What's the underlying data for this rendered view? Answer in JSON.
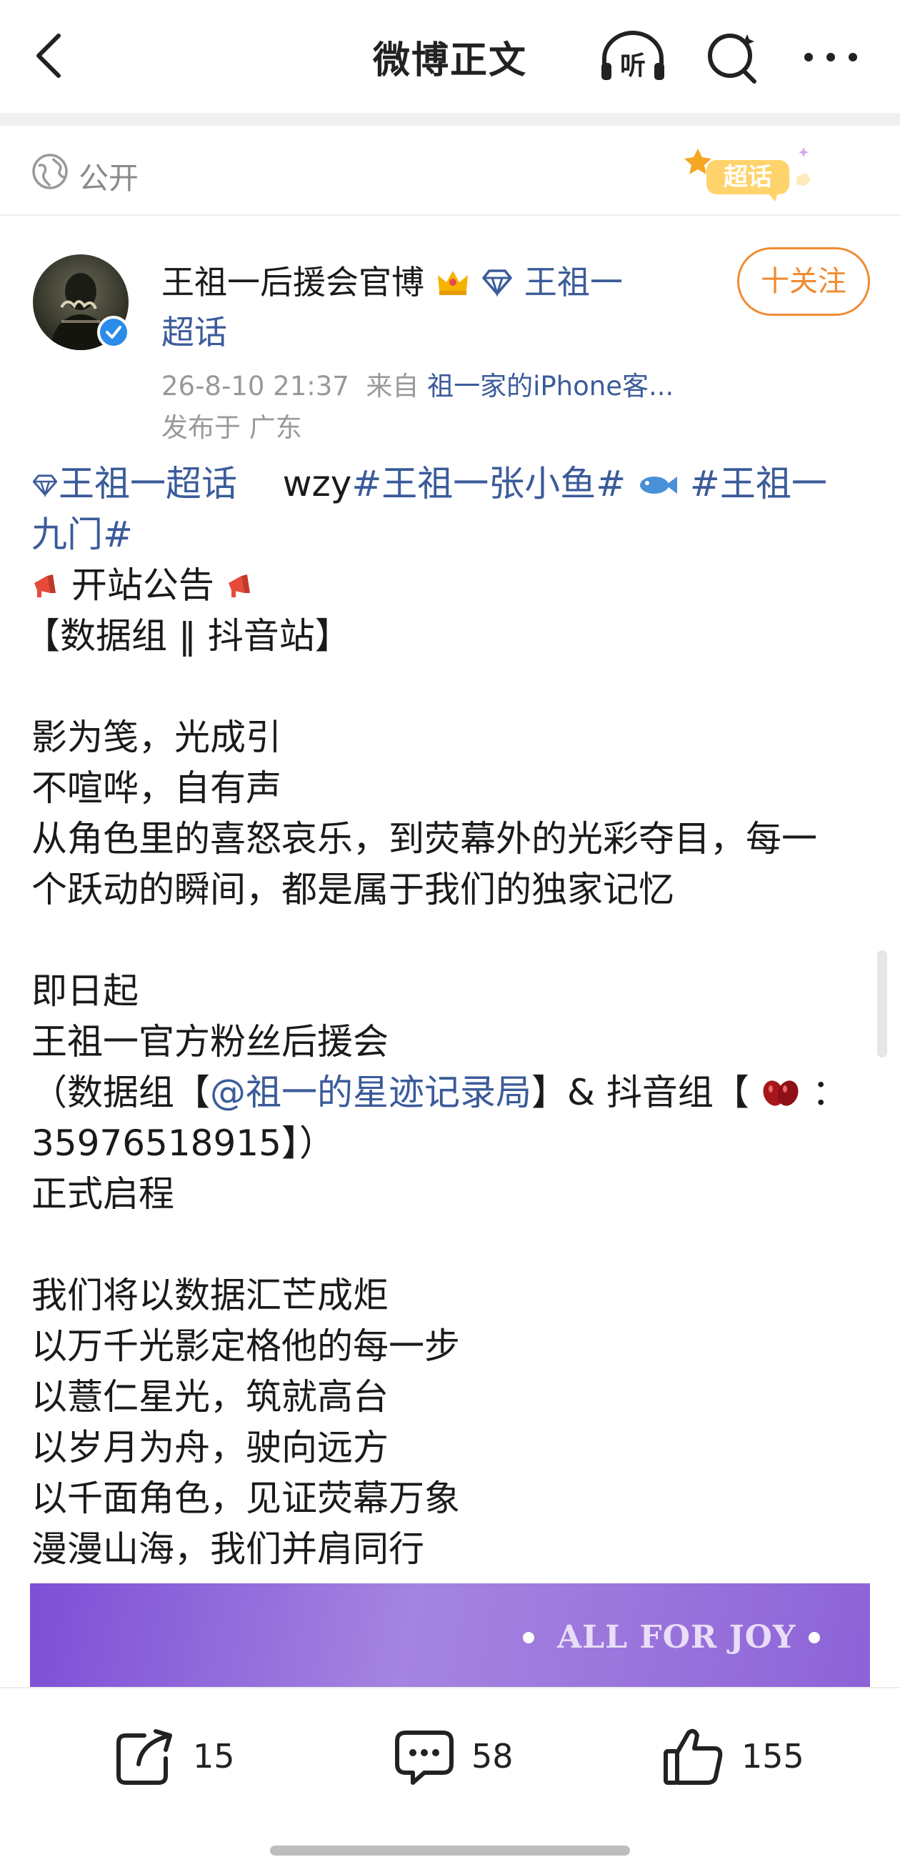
{
  "header": {
    "title": "微博正文"
  },
  "visibility": {
    "label": "公开"
  },
  "badge": {
    "text": "超话"
  },
  "author": {
    "name": "王祖一后援会官博",
    "chaohua_link_line1": "王祖一",
    "chaohua_link_line2": "超话",
    "follow_label": "十关注"
  },
  "meta": {
    "time": "26-8-10 21:37",
    "from_label": "来自",
    "source": "祖一家的iPhone客...",
    "location": "发布于 广东"
  },
  "post": {
    "topic_link": "王祖一超话",
    "plain_wzy": "wzy",
    "tag1": "#王祖一张小鱼#",
    "tag2_part1": "#王祖一",
    "tag2_part2": "九门#",
    "title_line": "开站公告",
    "group_line": "【数据组 ‖ 抖音站】",
    "p1": [
      "影为笺，光成引",
      "不喧哗，自有声",
      "从角色里的喜怒哀乐，到荧幕外的光彩夺目，每一",
      "个跃动的瞬间，都是属于我们的独家记忆"
    ],
    "p2_l1": "即日起",
    "p2_l2": "王祖一官方粉丝后援会",
    "p2_l3_a": "（数据组【",
    "p2_l3_link": "@祖一的星迹记录局",
    "p2_l3_b": "】& 抖音组【",
    "p2_l3_c": "：",
    "p2_l4": "35976518915】）",
    "p2_l5": "正式启程",
    "p3": [
      "我们将以数据汇芒成炬",
      "以万千光影定格他的每一步",
      "以薏仁星光，筑就高台",
      "以岁月为舟，驶向远方",
      "以千面角色，见证荧幕万象",
      "漫漫山海，我们并肩同行"
    ]
  },
  "image": {
    "text": "ALL FOR JOY"
  },
  "actions": {
    "repost_count": "15",
    "comment_count": "58",
    "like_count": "155"
  },
  "colors": {
    "link": "#3b5b9a",
    "accent": "#f08b32",
    "verify": "#2a8be8"
  }
}
